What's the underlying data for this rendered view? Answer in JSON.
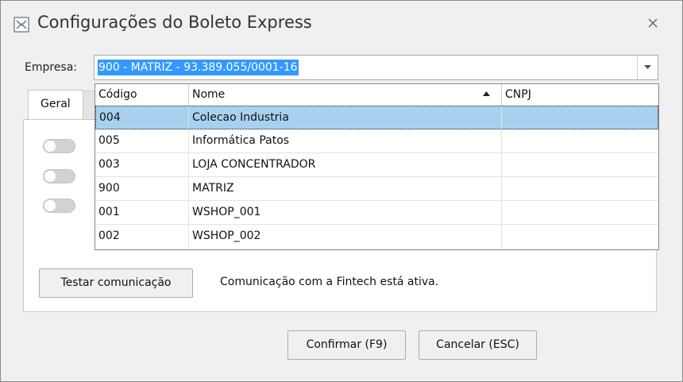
{
  "window": {
    "title": "Configurações do Boleto Express",
    "close_icon": "close-icon",
    "app_icon": "boleto-express-icon"
  },
  "empresa": {
    "label": "Empresa:",
    "selected_value": "900 - MATRIZ - 93.389.055/0001-16"
  },
  "tabs": [
    {
      "label": "Geral"
    }
  ],
  "grid": {
    "columns": [
      {
        "label": "Código"
      },
      {
        "label": "Nome",
        "sort": "ascending"
      },
      {
        "label": "CNPJ"
      }
    ],
    "rows": [
      {
        "code": "004",
        "name": "Colecao Industria",
        "cnpj": "",
        "selected": true
      },
      {
        "code": "005",
        "name": "Informática Patos",
        "cnpj": ""
      },
      {
        "code": "003",
        "name": "LOJA CONCENTRADOR",
        "cnpj": ""
      },
      {
        "code": "900",
        "name": "MATRIZ",
        "cnpj": ""
      },
      {
        "code": "001",
        "name": "WSHOP_001",
        "cnpj": ""
      },
      {
        "code": "002",
        "name": "WSHOP_002",
        "cnpj": ""
      }
    ]
  },
  "settings": {
    "toggles": [
      {
        "on": false
      },
      {
        "on": false
      },
      {
        "on": false
      }
    ]
  },
  "test": {
    "button_label": "Testar comunicação",
    "status_text": "Comunicação com a Fintech está ativa."
  },
  "footer": {
    "confirm_label": "Confirmar (F9)",
    "cancel_label": "Cancelar (ESC)"
  },
  "colors": {
    "selection_highlight": "#3399ff",
    "selected_row": "#a8d1f0",
    "window_bg": "#f0f0f0"
  }
}
